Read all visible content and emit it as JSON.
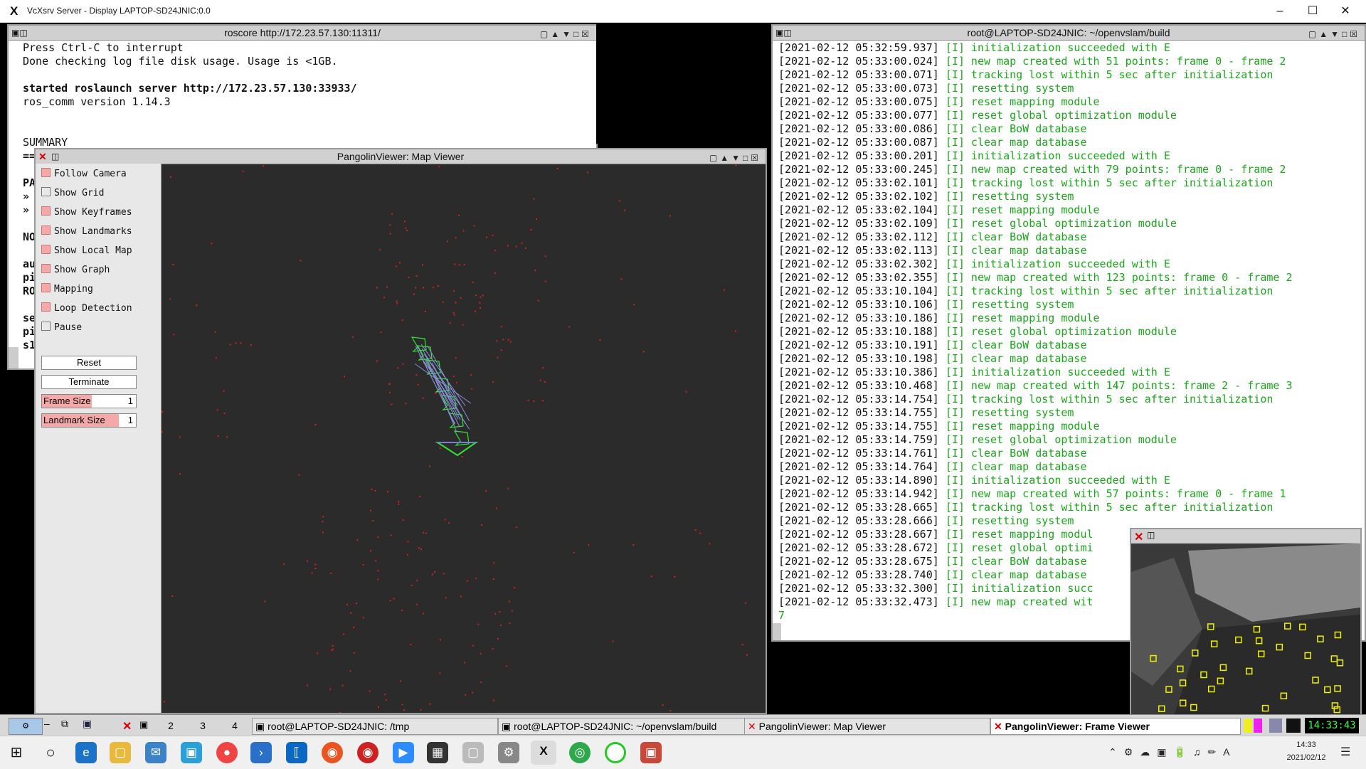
{
  "host": {
    "title": "VcXsrv Server - Display LAPTOP-SD24JNIC:0.0"
  },
  "roscore": {
    "title": "roscore http://172.23.57.130:11311/",
    "lines": [
      "Press Ctrl-C to interrupt",
      "Done checking log file disk usage. Usage is <1GB.",
      "",
      "started roslaunch server http://172.23.57.130:33933/",
      "ros_comm version 1.14.3",
      "",
      "",
      "SUMMARY"
    ],
    "left_fragments": [
      "==",
      "",
      "PA",
      "»",
      "»",
      "",
      "NO",
      "",
      "au",
      "pi",
      "RO",
      "",
      "se",
      "pi",
      "s1"
    ]
  },
  "pangolin": {
    "title": "PangolinViewer: Map Viewer",
    "checkboxes": [
      {
        "label": "Follow Camera",
        "checked": true
      },
      {
        "label": "Show Grid",
        "checked": false
      },
      {
        "label": "Show Keyframes",
        "checked": true
      },
      {
        "label": "Show Landmarks",
        "checked": true
      },
      {
        "label": "Show Local Map",
        "checked": true
      },
      {
        "label": "Show Graph",
        "checked": true
      },
      {
        "label": "Mapping",
        "checked": true
      },
      {
        "label": "Loop Detection",
        "checked": true
      },
      {
        "label": "Pause",
        "checked": false
      }
    ],
    "reset_label": "Reset",
    "terminate_label": "Terminate",
    "frame_size": {
      "label": "Frame Size",
      "value": "1"
    },
    "landmark_size": {
      "label": "Landmark Size",
      "value": "1"
    }
  },
  "log": {
    "title": "root@LAPTOP-SD24JNIC: ~/openvslam/build",
    "lines": [
      [
        "[2021-02-12 05:32:59.937]",
        "[I] initialization succeeded with E"
      ],
      [
        "[2021-02-12 05:33:00.024]",
        "[I] new map created with 51 points: frame 0 - frame 2"
      ],
      [
        "[2021-02-12 05:33:00.071]",
        "[I] tracking lost within 5 sec after initialization"
      ],
      [
        "[2021-02-12 05:33:00.073]",
        "[I] resetting system"
      ],
      [
        "[2021-02-12 05:33:00.075]",
        "[I] reset mapping module"
      ],
      [
        "[2021-02-12 05:33:00.077]",
        "[I] reset global optimization module"
      ],
      [
        "[2021-02-12 05:33:00.086]",
        "[I] clear BoW database"
      ],
      [
        "[2021-02-12 05:33:00.087]",
        "[I] clear map database"
      ],
      [
        "[2021-02-12 05:33:00.201]",
        "[I] initialization succeeded with E"
      ],
      [
        "[2021-02-12 05:33:00.245]",
        "[I] new map created with 79 points: frame 0 - frame 2"
      ],
      [
        "[2021-02-12 05:33:02.101]",
        "[I] tracking lost within 5 sec after initialization"
      ],
      [
        "[2021-02-12 05:33:02.102]",
        "[I] resetting system"
      ],
      [
        "[2021-02-12 05:33:02.104]",
        "[I] reset mapping module"
      ],
      [
        "[2021-02-12 05:33:02.109]",
        "[I] reset global optimization module"
      ],
      [
        "[2021-02-12 05:33:02.112]",
        "[I] clear BoW database"
      ],
      [
        "[2021-02-12 05:33:02.113]",
        "[I] clear map database"
      ],
      [
        "[2021-02-12 05:33:02.302]",
        "[I] initialization succeeded with E"
      ],
      [
        "[2021-02-12 05:33:02.355]",
        "[I] new map created with 123 points: frame 0 - frame 2"
      ],
      [
        "[2021-02-12 05:33:10.104]",
        "[I] tracking lost within 5 sec after initialization"
      ],
      [
        "[2021-02-12 05:33:10.106]",
        "[I] resetting system"
      ],
      [
        "[2021-02-12 05:33:10.186]",
        "[I] reset mapping module"
      ],
      [
        "[2021-02-12 05:33:10.188]",
        "[I] reset global optimization module"
      ],
      [
        "[2021-02-12 05:33:10.191]",
        "[I] clear BoW database"
      ],
      [
        "[2021-02-12 05:33:10.198]",
        "[I] clear map database"
      ],
      [
        "[2021-02-12 05:33:10.386]",
        "[I] initialization succeeded with E"
      ],
      [
        "[2021-02-12 05:33:10.468]",
        "[I] new map created with 147 points: frame 2 - frame 3"
      ],
      [
        "[2021-02-12 05:33:14.754]",
        "[I] tracking lost within 5 sec after initialization"
      ],
      [
        "[2021-02-12 05:33:14.755]",
        "[I] resetting system"
      ],
      [
        "[2021-02-12 05:33:14.755]",
        "[I] reset mapping module"
      ],
      [
        "[2021-02-12 05:33:14.759]",
        "[I] reset global optimization module"
      ],
      [
        "[2021-02-12 05:33:14.761]",
        "[I] clear BoW database"
      ],
      [
        "[2021-02-12 05:33:14.764]",
        "[I] clear map database"
      ],
      [
        "[2021-02-12 05:33:14.890]",
        "[I] initialization succeeded with E"
      ],
      [
        "[2021-02-12 05:33:14.942]",
        "[I] new map created with 57 points: frame 0 - frame 1"
      ],
      [
        "[2021-02-12 05:33:28.665]",
        "[I] tracking lost within 5 sec after initialization"
      ],
      [
        "[2021-02-12 05:33:28.666]",
        "[I] resetting system"
      ],
      [
        "[2021-02-12 05:33:28.667]",
        "[I] reset mapping modul"
      ],
      [
        "[2021-02-12 05:33:28.672]",
        "[I] reset global optimi"
      ],
      [
        "[2021-02-12 05:33:28.675]",
        "[I] clear BoW database"
      ],
      [
        "[2021-02-12 05:33:28.740]",
        "[I] clear map database"
      ],
      [
        "[2021-02-12 05:33:32.300]",
        "[I] initialization succ"
      ],
      [
        "[2021-02-12 05:33:32.473]",
        "[I] new map created wit"
      ]
    ],
    "cursor_line": "7"
  },
  "xtaskbar": {
    "desktops": [
      "2",
      "3",
      "4"
    ],
    "tasks": [
      "root@LAPTOP-SD24JNIC: /tmp",
      "root@LAPTOP-SD24JNIC: ~/openvslam/build",
      "PangolinViewer: Map Viewer",
      "PangolinViewer: Frame Viewer"
    ],
    "clock": "14:33:43"
  },
  "wintaskbar": {
    "time": "14:33",
    "date": "2021/02/12"
  }
}
